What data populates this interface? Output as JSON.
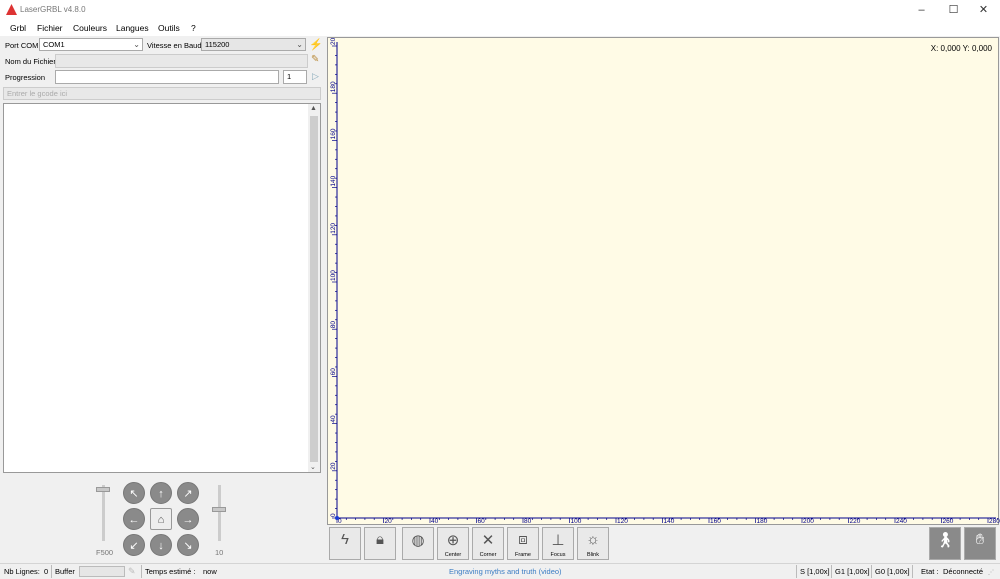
{
  "window": {
    "title": "LaserGRBL v4.8.0",
    "controls": [
      "–",
      "☐",
      "✕"
    ]
  },
  "menu": [
    "Grbl",
    "Fichier",
    "Couleurs",
    "Langues",
    "Outils",
    "?"
  ],
  "connection": {
    "port_label": "Port COM",
    "port_value": "COM1",
    "baud_label": "Vitesse en Baud",
    "baud_value": "115200"
  },
  "file": {
    "label": "Nom du Fichier",
    "value": ""
  },
  "progress": {
    "label": "Progression",
    "count": "1"
  },
  "gcode_input": {
    "placeholder": "Entrer le gcode ici"
  },
  "jog": {
    "feed_label": "F500",
    "step_label": "10"
  },
  "canvas": {
    "coord_text": "X: 0,000 Y: 0,000",
    "x_ticks": [
      "0",
      "20",
      "40",
      "60",
      "80",
      "100",
      "120",
      "140",
      "160",
      "180",
      "200",
      "220",
      "240",
      "260",
      "280"
    ],
    "y_ticks": [
      "0",
      "20",
      "40",
      "60",
      "80",
      "100",
      "120",
      "140",
      "160",
      "180",
      "200"
    ]
  },
  "toolbar": [
    {
      "icon": "lightning-icon",
      "caption": ""
    },
    {
      "icon": "lock-icon",
      "caption": ""
    },
    {
      "icon": "globe-icon",
      "caption": ""
    },
    {
      "icon": "center-icon",
      "caption": "Center"
    },
    {
      "icon": "corner-icon",
      "caption": "Corner"
    },
    {
      "icon": "frame-icon",
      "caption": "Frame"
    },
    {
      "icon": "focus-icon",
      "caption": "Focus"
    },
    {
      "icon": "blink-icon",
      "caption": "Blink"
    }
  ],
  "status": {
    "lines_label": "Nb Lignes:",
    "lines_value": "0",
    "buffer_label": "Buffer",
    "time_label": "Temps estimé :",
    "time_value": "now",
    "link_text": "Engraving myths and truth (video)",
    "s_override": "S [1,00x]",
    "g1_override": "G1 [1,00x]",
    "g0_override": "G0 [1,00x]",
    "state_label": "Etat :",
    "state_value": "Déconnecté"
  },
  "colors": {
    "canvas_bg": "#fffbe6",
    "link": "#3b7dc4"
  }
}
